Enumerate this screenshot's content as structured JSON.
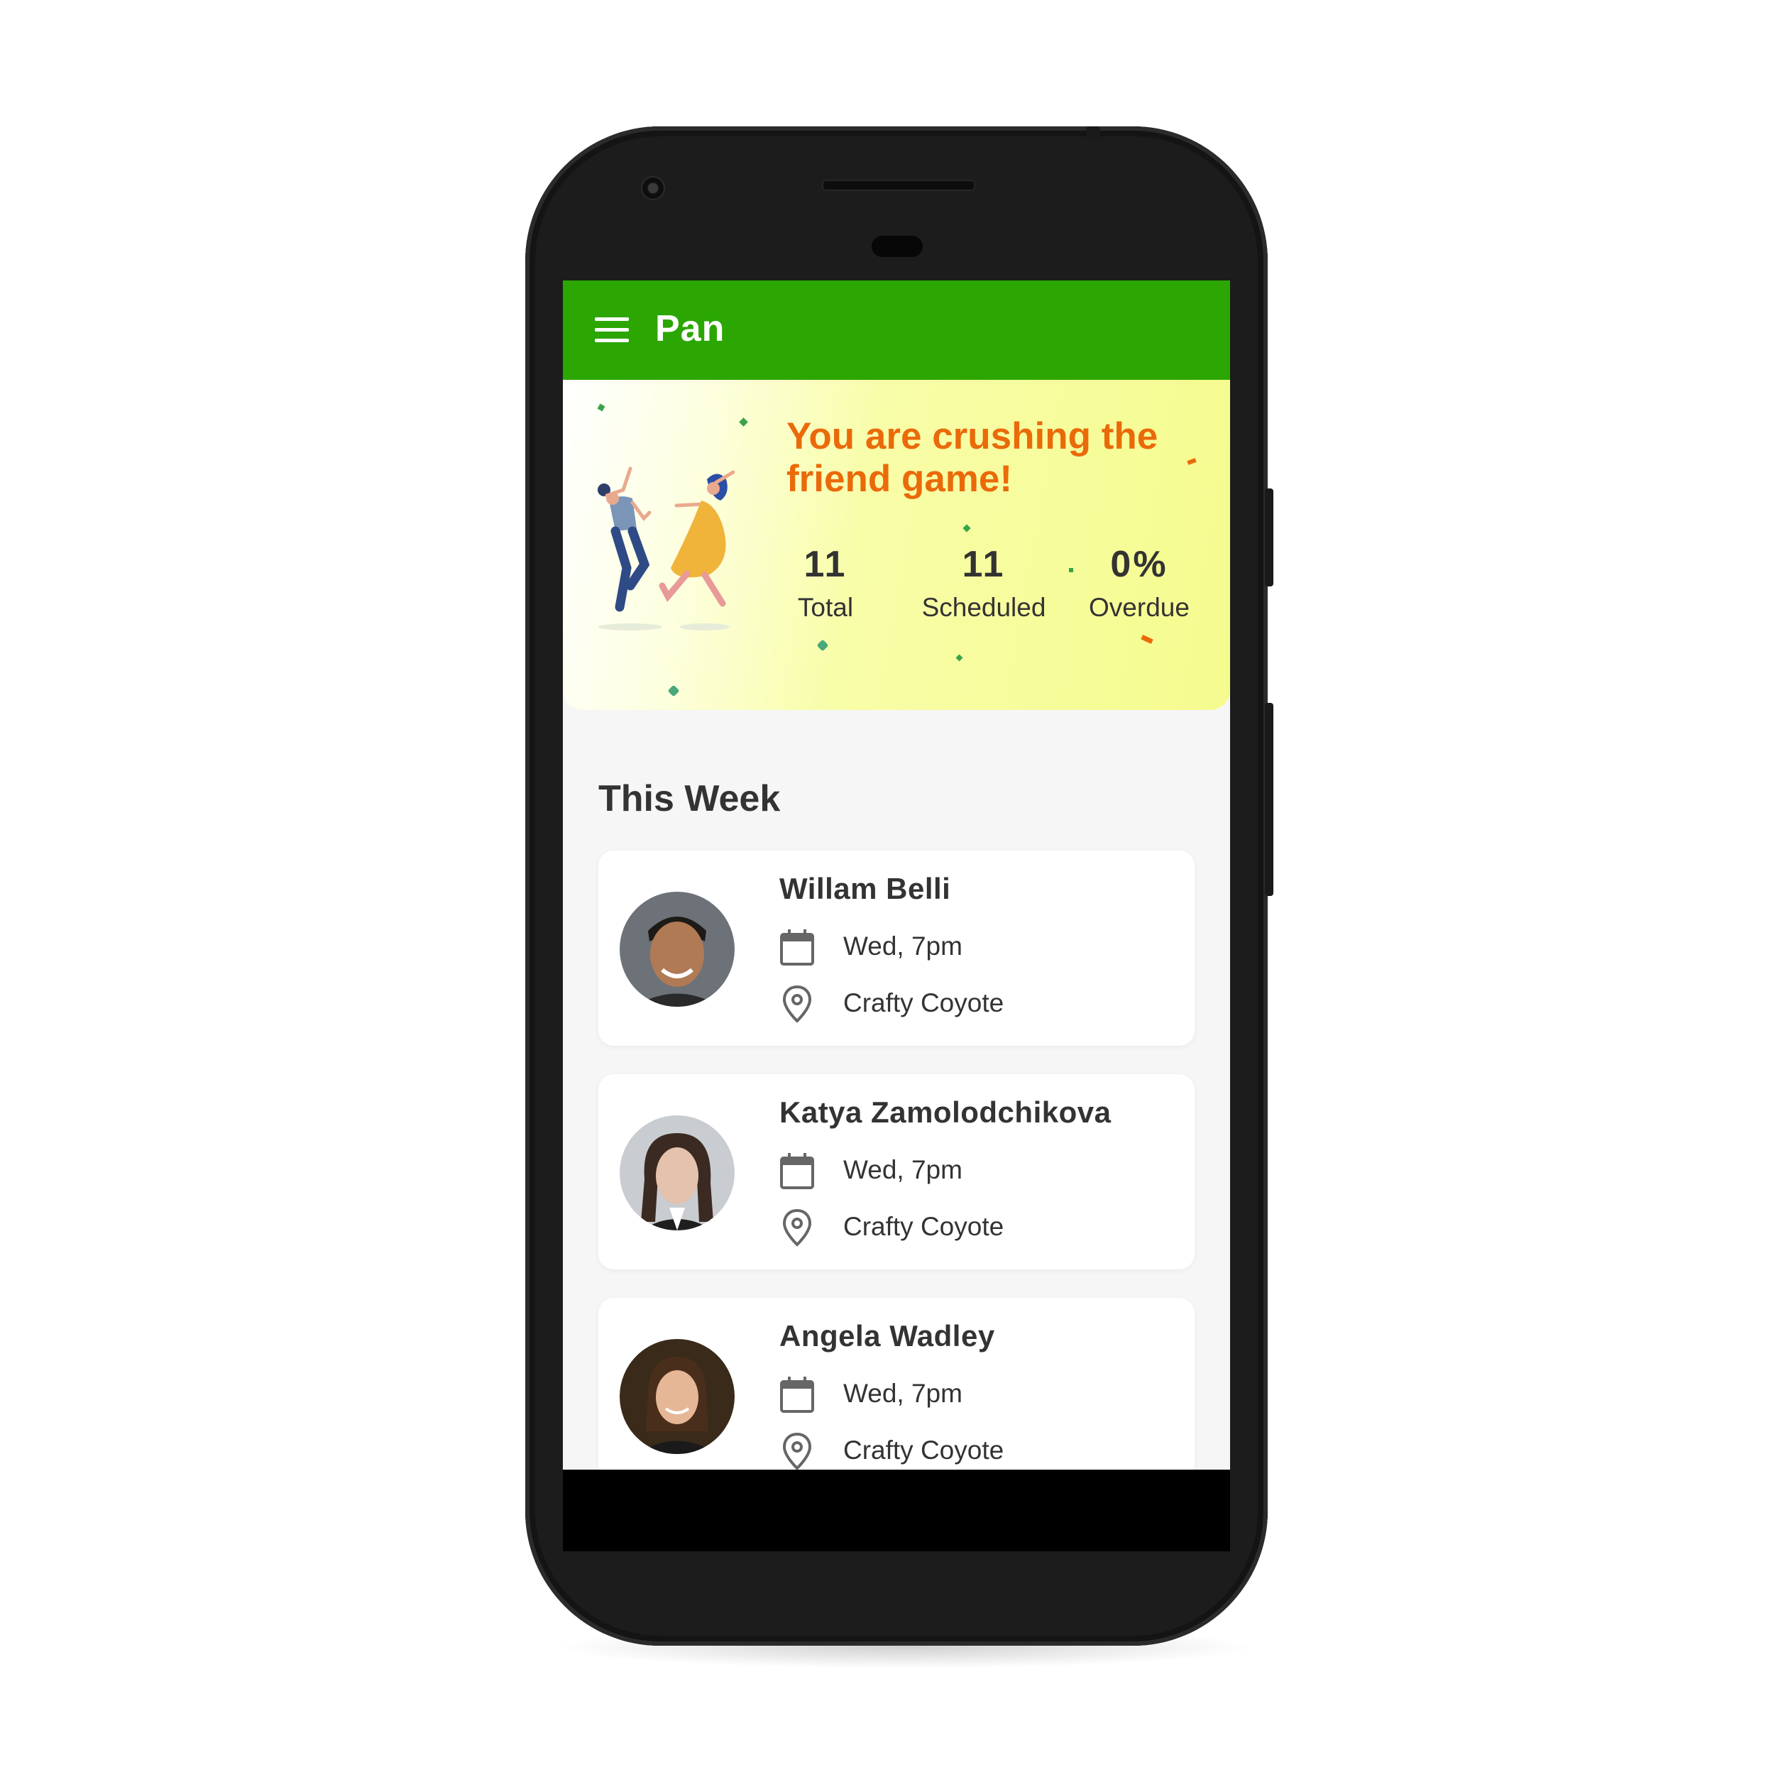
{
  "app": {
    "title": "Pan",
    "brand_color": "#2ba602",
    "accent_color": "#ea6a0a"
  },
  "banner": {
    "headline": "You are crushing the friend game!",
    "stats": [
      {
        "value": "11",
        "label": "Total"
      },
      {
        "value": "11",
        "label": "Scheduled"
      },
      {
        "value": "0%",
        "label": "Overdue"
      }
    ]
  },
  "section": {
    "title": "This Week"
  },
  "friends": [
    {
      "name": "Willam Belli",
      "when": "Wed, 7pm",
      "where": "Crafty Coyote"
    },
    {
      "name": "Katya Zamolodchikova",
      "when": "Wed, 7pm",
      "where": "Crafty Coyote"
    },
    {
      "name": "Angela Wadley",
      "when": "Wed, 7pm",
      "where": "Crafty Coyote"
    }
  ],
  "icons": {
    "menu": "menu-icon",
    "calendar": "calendar-icon",
    "location": "location-pin-icon"
  }
}
